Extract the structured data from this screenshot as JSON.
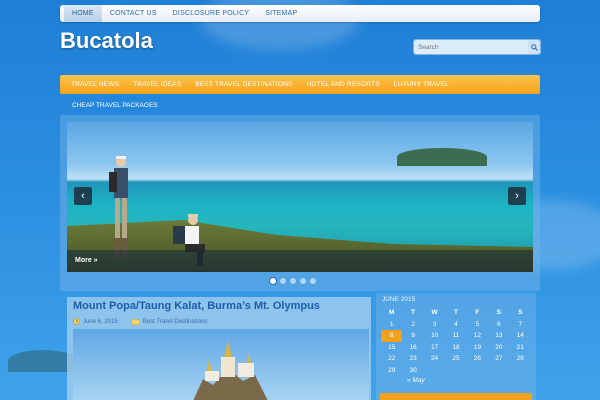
{
  "top_nav": {
    "items": [
      {
        "label": "HOME",
        "active": true
      },
      {
        "label": "CONTACT US"
      },
      {
        "label": "DISCLOSURE POLICY"
      },
      {
        "label": "SITEMAP"
      }
    ]
  },
  "site": {
    "title": "Bucatola"
  },
  "search": {
    "placeholder": "Search",
    "icon": "search-icon"
  },
  "main_nav": {
    "items": [
      {
        "label": "TRAVEL NEWS"
      },
      {
        "label": "TRAVEL IDEAS"
      },
      {
        "label": "BEST TRAVEL DESTINATIONS"
      },
      {
        "label": "HOTEL AND RESORTS"
      },
      {
        "label": "LUXURY TRAVEL"
      }
    ],
    "second_row": [
      {
        "label": "CHEAP TRAVEL PACKAGES"
      }
    ]
  },
  "slider": {
    "caption": "More »",
    "prev": "‹",
    "next": "›",
    "dot_count": 5,
    "active_dot": 0
  },
  "post": {
    "title": "Mount Popa/Taung Kalat, Burma’s Mt. Olympus",
    "date": "June 6, 2015",
    "category": "Best Travel Destinations"
  },
  "calendar": {
    "month": "JUNE 2015",
    "weekdays": [
      "M",
      "T",
      "W",
      "T",
      "F",
      "S",
      "S"
    ],
    "weeks": [
      [
        "1",
        "2",
        "3",
        "4",
        "5",
        "6",
        "7"
      ],
      [
        "8",
        "9",
        "10",
        "11",
        "12",
        "13",
        "14"
      ],
      [
        "15",
        "16",
        "17",
        "18",
        "19",
        "20",
        "21"
      ],
      [
        "22",
        "23",
        "24",
        "25",
        "26",
        "27",
        "28"
      ],
      [
        "29",
        "30",
        "",
        "",
        "",
        "",
        ""
      ]
    ],
    "highlight": "8",
    "prev_link": "« May"
  },
  "colors": {
    "accent_orange": "#f3a21d",
    "brand_blue": "#2a6ab5"
  }
}
